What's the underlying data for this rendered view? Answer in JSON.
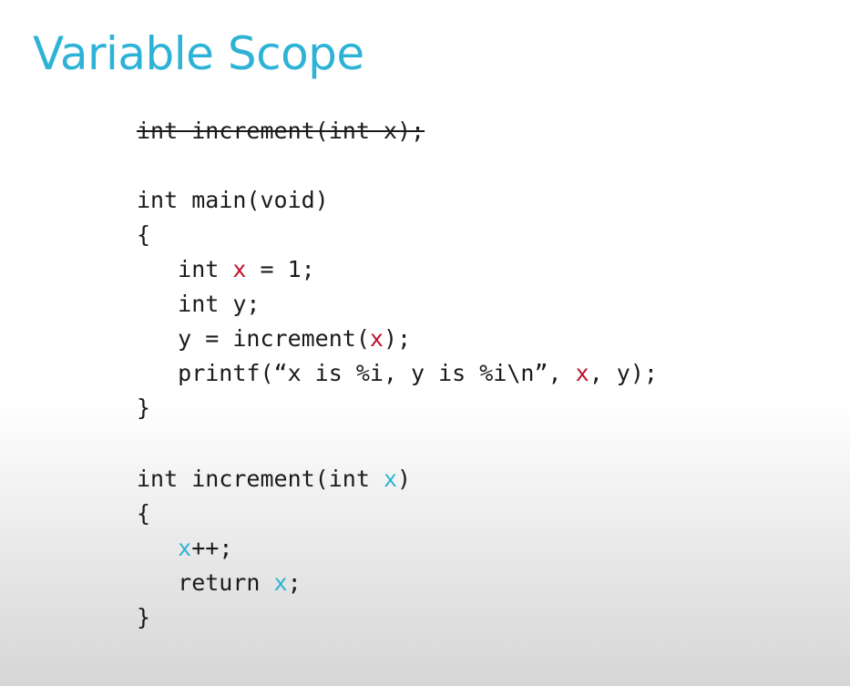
{
  "slide": {
    "title": "Variable Scope"
  },
  "code": {
    "line1": "int increment(int x);",
    "line2": "int main(void)",
    "line3": "{",
    "line4_a": "   int ",
    "line4_var": "x",
    "line4_b": " = 1;",
    "line5": "   int y;",
    "line6_a": "   y = increment(",
    "line6_var": "x",
    "line6_b": ");",
    "line7_a": "   printf(“x is %i, y is %i\\n”, ",
    "line7_var": "x",
    "line7_b": ", y);",
    "line8": "}",
    "line9_a": "int increment(int ",
    "line9_var": "x",
    "line9_b": ")",
    "line10": "{",
    "line11_a": "   ",
    "line11_var": "x",
    "line11_b": "++;",
    "line12_a": "   return ",
    "line12_var": "x",
    "line12_b": ";",
    "line13": "}"
  },
  "colors": {
    "title": "#2eb3d6",
    "main_scope_x": "#c00f2c",
    "increment_scope_x": "#2eb3d6"
  }
}
